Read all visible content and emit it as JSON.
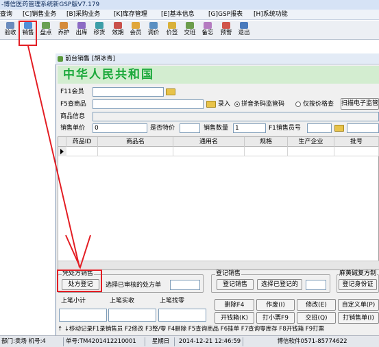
{
  "window": {
    "title": "-博信医药管理系统新GSP版V7.179"
  },
  "menu": {
    "items": [
      "查询",
      "[C]销售业务",
      "[B]采购业务",
      "[K]库存管理",
      "[E]基本信息",
      "[G]GSP报表",
      "[H]系统功能"
    ]
  },
  "toolbar": {
    "items": [
      {
        "label": "验收",
        "icon": "check-icon",
        "color": "#6a8bbd"
      },
      {
        "label": "销售",
        "icon": "sale-icon",
        "color": "#4f8fd8"
      },
      {
        "label": "盘点",
        "icon": "inventory-icon",
        "color": "#6aa052"
      },
      {
        "label": "养护",
        "icon": "maintain-icon",
        "color": "#d58b3a"
      },
      {
        "label": "出库",
        "icon": "outbound-icon",
        "color": "#8c6bc4"
      },
      {
        "label": "移货",
        "icon": "move-icon",
        "color": "#3d9ea8"
      },
      {
        "label": "效期",
        "icon": "expiry-icon",
        "color": "#c9504a"
      },
      {
        "label": "会员",
        "icon": "member-icon",
        "color": "#e0a63a"
      },
      {
        "label": "调价",
        "icon": "price-icon",
        "color": "#5a8fc2"
      },
      {
        "label": "价签",
        "icon": "tag-icon",
        "color": "#d9b13a"
      },
      {
        "label": "交班",
        "icon": "shift-icon",
        "color": "#6c9d4c"
      },
      {
        "label": "备忘",
        "icon": "memo-icon",
        "color": "#b47bc0"
      },
      {
        "label": "预警",
        "icon": "alert-icon",
        "color": "#d0544a"
      },
      {
        "label": "退出",
        "icon": "exit-icon",
        "color": "#4a7abc"
      }
    ]
  },
  "subwindow": {
    "title": "前台销售 [胡冰青]",
    "banner": "中华人民共和国"
  },
  "form": {
    "member_label": "F11会员",
    "product_search_label": "F5查商品",
    "entry_label": "录入",
    "radio_barcode": "拼音条码监管码",
    "radio_price_only": "仅按价格查",
    "scan_button": "扫描电子监管",
    "product_info_label": "商品信息",
    "unit_price_label": "销售单价",
    "unit_price_value": "0",
    "special_price_label": "是否特价",
    "quantity_label": "销售数量",
    "quantity_value": "1",
    "seller_label": "F1销售员号"
  },
  "grid": {
    "columns": [
      "药品ID",
      "商品名",
      "通用名",
      "规格",
      "生产企业",
      "批号"
    ]
  },
  "groups": {
    "prescription": {
      "title": "凭处方销售",
      "button": "处方登记",
      "select_label": "选择已审核的处方单"
    },
    "register": {
      "title": "登记销售",
      "register_button": "登记销售",
      "select_button": "选择已登记的"
    },
    "ephedrine": {
      "title": "麻黄碱复方制",
      "button": "登记身份证"
    }
  },
  "totals": {
    "subtotal_label": "上笔小计",
    "received_label": "上笔实收",
    "change_label": "上笔找零"
  },
  "actions": {
    "delete": "删除F4",
    "void": "作废(I)",
    "modify": "修改(E)",
    "custom": "自定义单(P)",
    "cashbox": "开钱箱(K)",
    "print_receipt": "打小票F9",
    "handover": "交班(Q)",
    "print_sale": "打销售单(I)"
  },
  "shortcuts": {
    "text": "↑ ↓移动记录F1录销售员 F2修改 F3整/零 F4删除 F5查询商品 F6挂单 F7查询零库存 F8开钱箱 F9打票"
  },
  "status": {
    "dept": "部门:卖场 机号:4",
    "bill": "单号:TM4201412210001",
    "weekday": "星期日",
    "datetime": "2014-12-21 12:46:59",
    "vendor": "博信软件0571-85774622"
  }
}
